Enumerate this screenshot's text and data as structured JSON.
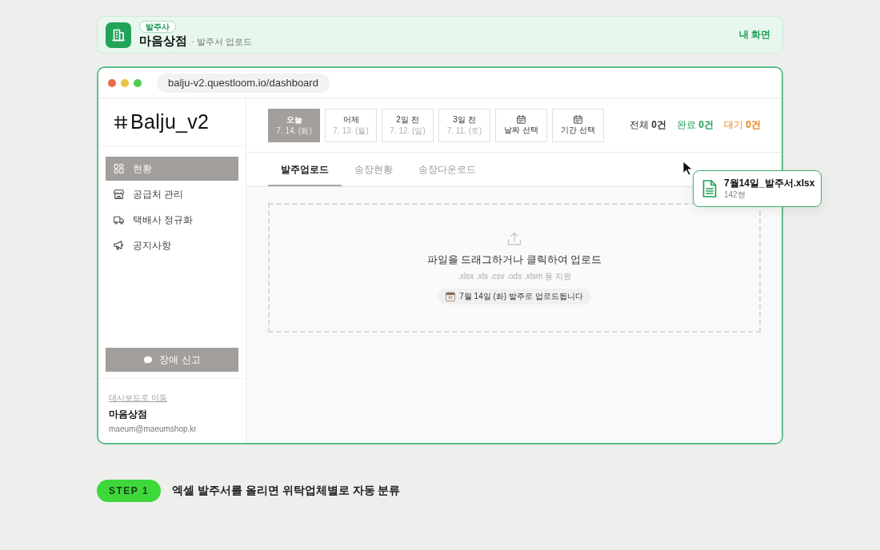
{
  "banner": {
    "badge": "발주사",
    "shop_name": "마음상점",
    "subtitle": "· 발주서 업로드",
    "link": "내 화면"
  },
  "browser": {
    "url": "balju-v2.questloom.io/dashboard"
  },
  "sidebar": {
    "logo": "Balju_v2",
    "items": [
      {
        "label": "현황",
        "selected": true
      },
      {
        "label": "공급처 관리",
        "selected": false
      },
      {
        "label": "택배사 정규화",
        "selected": false
      },
      {
        "label": "공지사항",
        "selected": false
      }
    ],
    "report_button": "장애 신고",
    "footer": {
      "link": "대시보드로 이동",
      "shop_name": "마음상점",
      "email": "maeum@maeumshop.kr"
    }
  },
  "date_filters": [
    {
      "kind": "date",
      "label": "오늘",
      "date": "7. 14. (화)",
      "selected": true
    },
    {
      "kind": "date",
      "label": "어제",
      "date": "7. 13. (월)",
      "selected": false
    },
    {
      "kind": "date",
      "label": "2일 전",
      "date": "7. 12. (일)",
      "selected": false
    },
    {
      "kind": "date",
      "label": "3일 전",
      "date": "7. 11. (토)",
      "selected": false
    },
    {
      "kind": "picker",
      "label": "날짜 선택",
      "selected": false
    },
    {
      "kind": "picker",
      "label": "기간 선택",
      "selected": false
    }
  ],
  "counts": [
    {
      "text": "전체 **0건**",
      "color": "#333333"
    },
    {
      "text": "완료 **0건**",
      "color": "#1f9d55"
    },
    {
      "text": "대기 **0건**",
      "color": "#e8820c"
    }
  ],
  "tabs": [
    {
      "label": "발주업로드",
      "selected": true
    },
    {
      "label": "송장현황",
      "selected": false
    },
    {
      "label": "송장다운로드",
      "selected": false
    }
  ],
  "dropzone": {
    "title": "파일을 드래그하거나 클릭하여 업로드",
    "formats": ".xlsx .xls .csv .ods .xlsm 등 지원",
    "notice": "7월 14일 (화) 발주로 업로드됩니다"
  },
  "drag_file": {
    "name": "7월14일_발주서.xlsx",
    "rows": "142행"
  },
  "step": {
    "badge": "STEP 1",
    "caption": "엑셀 발주서를 올리면 위탁업체별로 자동 분류"
  }
}
